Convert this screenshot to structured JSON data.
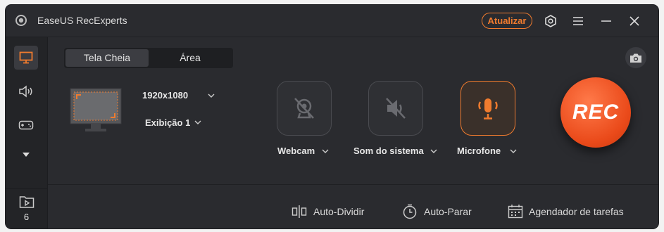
{
  "app": {
    "title": "EaseUS RecExperts",
    "upgrade_label": "Atualizar"
  },
  "sidebar": {
    "items": [
      {
        "icon": "monitor-icon"
      },
      {
        "icon": "speaker-icon"
      },
      {
        "icon": "gamepad-icon"
      },
      {
        "icon": "triangle-down-icon"
      }
    ],
    "recordings_count": "6"
  },
  "tabs": [
    {
      "label": "Tela Cheia",
      "active": true
    },
    {
      "label": "Área",
      "active": false
    }
  ],
  "display": {
    "resolution": "1920x1080",
    "monitor": "Exibição 1"
  },
  "sources": [
    {
      "label": "Webcam",
      "enabled": false
    },
    {
      "label": "Som do sistema",
      "enabled": false
    },
    {
      "label": "Microfone",
      "enabled": true
    }
  ],
  "rec_label": "REC",
  "tools": [
    {
      "label": "Auto-Dividir",
      "icon": "split-icon"
    },
    {
      "label": "Auto-Parar",
      "icon": "timer-icon"
    },
    {
      "label": "Agendador de tarefas",
      "icon": "calendar-icon"
    }
  ],
  "colors": {
    "accent": "#f07b2e",
    "rec": "#ea4a1a",
    "bg": "#2a2b2f"
  }
}
